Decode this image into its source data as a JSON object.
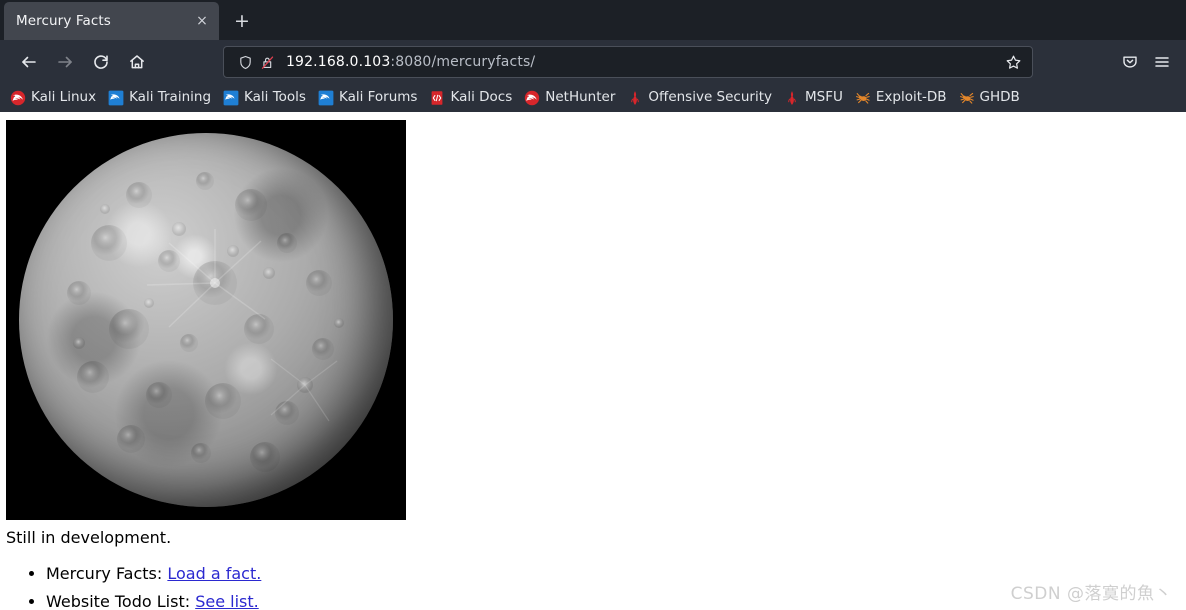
{
  "browser": {
    "tabs": [
      {
        "title": "Mercury Facts",
        "close_label": "×",
        "icon": "tab-close-icon"
      }
    ],
    "new_tab_label": "+",
    "nav": {
      "back": "back-icon",
      "forward": "forward-icon",
      "reload": "reload-icon",
      "home": "home-icon"
    },
    "urlbar": {
      "shield_icon": "tracking-protection-shield-icon",
      "lock_icon": "insecure-connection-icon",
      "host": "192.168.0.103",
      "path": ":8080/mercuryfacts/",
      "full_url": "192.168.0.103:8080/mercuryfacts/",
      "star_icon": "bookmark-star-icon"
    },
    "toolbar_right": {
      "pocket": "save-to-pocket-icon",
      "menu": "application-menu-icon"
    },
    "bookmarks": [
      {
        "label": "Kali Linux",
        "icon": "kali-dragon-icon"
      },
      {
        "label": "Kali Training",
        "icon": "kali-training-icon"
      },
      {
        "label": "Kali Tools",
        "icon": "kali-tools-icon"
      },
      {
        "label": "Kali Forums",
        "icon": "kali-forums-icon"
      },
      {
        "label": "Kali Docs",
        "icon": "kali-docs-icon"
      },
      {
        "label": "NetHunter",
        "icon": "nethunter-icon"
      },
      {
        "label": "Offensive Security",
        "icon": "offensive-security-icon"
      },
      {
        "label": "MSFU",
        "icon": "msfu-icon"
      },
      {
        "label": "Exploit-DB",
        "icon": "exploit-db-spider-icon"
      },
      {
        "label": "GHDB",
        "icon": "ghdb-spider-icon"
      }
    ]
  },
  "page": {
    "hero_image_alt": "mercury-planet-image",
    "status_text": "Still in development.",
    "list": [
      {
        "label": "Mercury Facts:",
        "link_text": "Load a fact."
      },
      {
        "label": "Website Todo List:",
        "link_text": "See list."
      }
    ]
  },
  "watermark": "CSDN @落寞的魚丶",
  "colors": {
    "tabstrip_bg": "#1c2026",
    "toolbar_bg": "#2b303a",
    "active_tab_bg": "#42464e",
    "url_text": "#ffffff",
    "url_path": "#b9bec7",
    "link": "#2b29d0",
    "kali_red": "#d7262b",
    "kali_blue": "#1f7fd4",
    "spider_orange": "#e3862a"
  }
}
